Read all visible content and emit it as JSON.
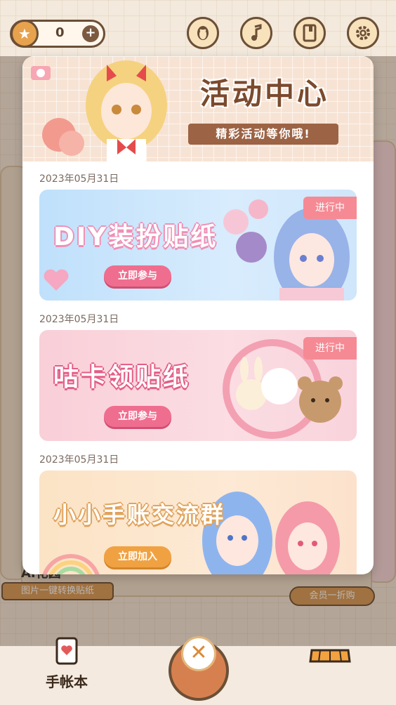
{
  "topbar": {
    "coins": "0",
    "plus": "+",
    "icons": [
      "penguin-icon",
      "music-note-icon",
      "book-icon",
      "gear-icon"
    ]
  },
  "modal": {
    "title": "活动中心",
    "subtitle": "精彩活动等你哦!",
    "events": [
      {
        "date": "2023年05月31日",
        "title": "DIY装扮贴纸",
        "cta": "立即参与",
        "status": "进行中"
      },
      {
        "date": "2023年05月31日",
        "title": "咕卡领贴纸",
        "cta": "立即参与",
        "status": "进行中"
      },
      {
        "date": "2023年05月31日",
        "title": "小小手账交流群",
        "cta": "立即加入"
      }
    ]
  },
  "background": {
    "ai_title": "AI花园",
    "ai_caption": "图片一键转换贴纸",
    "member_caption": "会员一折购"
  },
  "bottom_nav": {
    "journal_label": "手帐本",
    "close_glyph": "✕"
  },
  "colors": {
    "accent_brown": "#6b4f36",
    "pink_cta": "#ef6e8f",
    "orange_cta": "#f0a242",
    "status_pink": "#f58a94"
  }
}
